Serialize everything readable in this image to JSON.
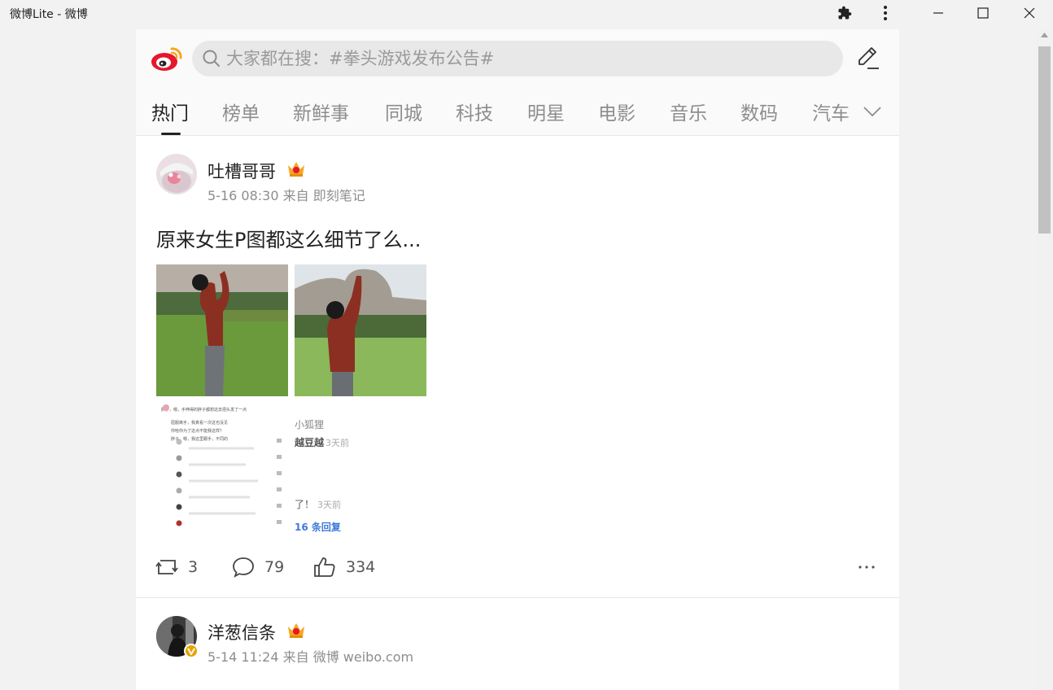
{
  "window": {
    "title": "微博Lite - 微博"
  },
  "header": {
    "search_placeholder": "大家都在搜：#拳头游戏发布公告#",
    "tabs": [
      {
        "label": "热门"
      },
      {
        "label": "榜单"
      },
      {
        "label": "新鲜事"
      },
      {
        "label": "同城"
      },
      {
        "label": "科技"
      },
      {
        "label": "明星"
      },
      {
        "label": "电影"
      },
      {
        "label": "音乐"
      },
      {
        "label": "数码"
      },
      {
        "label": "汽车"
      }
    ]
  },
  "posts": [
    {
      "author": "吐槽哥哥",
      "time": "5-16 08:30",
      "source": "来自 即刻笔记",
      "text": "原来女生P图都这么细节了么...",
      "image_captions": {
        "img3": [
          "胖子，嗯，手伸得的胖子都想这去把头发了一点",
          "屈服离手，我真看一次这也没见",
          "你哈你为了这点不能我这样？",
          "胖子，嗯，我这里跟手，不同的"
        ],
        "img4": [
          "小狐狸",
          "越豆越",
          "3天前",
          "了！",
          "3天前",
          "16 条回复"
        ]
      },
      "reposts": "3",
      "comments": "79",
      "likes": "334"
    },
    {
      "author": "洋葱信条",
      "time": "5-14 11:24",
      "source": "来自 微博 weibo.com"
    }
  ],
  "colors": {
    "brand_red": "#e6162d",
    "vip_gold": "#f5a623",
    "accent_blue": "#3e7ad9"
  },
  "icons": [
    "puzzle-icon",
    "kebab-menu-icon",
    "minimize-icon",
    "maximize-icon",
    "close-icon",
    "weibo-logo-icon",
    "search-icon",
    "compose-icon",
    "chevron-down-icon",
    "repost-icon",
    "comment-icon",
    "like-icon",
    "more-icon"
  ]
}
